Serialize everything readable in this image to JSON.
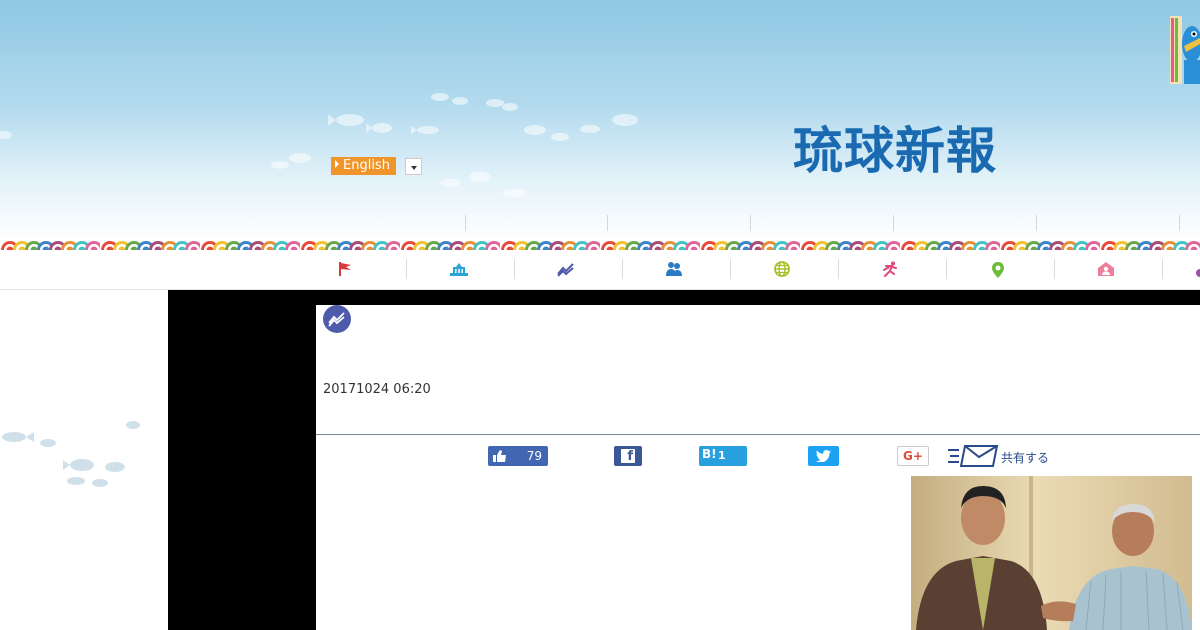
{
  "header": {
    "language": {
      "selected": "English"
    },
    "logo_text": "琉球新報"
  },
  "nav": {
    "items": [
      {
        "icon": "flag-icon",
        "color": "#d63a3a"
      },
      {
        "icon": "government-building-icon",
        "color": "#2aa6d6"
      },
      {
        "icon": "economy-chart-icon",
        "color": "#4e5bab"
      },
      {
        "icon": "people-icon",
        "color": "#2a7ac4"
      },
      {
        "icon": "globe-icon",
        "color": "#a8bf2a"
      },
      {
        "icon": "sports-runner-icon",
        "color": "#e0477f"
      },
      {
        "icon": "location-pin-icon",
        "color": "#6cbc3a"
      },
      {
        "icon": "home-person-icon",
        "color": "#ee7f9b"
      }
    ]
  },
  "article": {
    "category_icon": "economy-chart-icon",
    "category_color": "#4e5bab",
    "datetime": "20171024 06:20",
    "share": {
      "like_count": "79",
      "hatena_label": "B!",
      "hatena_count": "1",
      "google_label": "G+",
      "mail_label": "共有する"
    }
  },
  "colors": {
    "header_sky": "#8ec7e3",
    "logo": "#1a6ab1",
    "language_button": "#f0952a",
    "facebook": "#3b5998",
    "twitter": "#1da1f2",
    "hatena": "#26a0de"
  }
}
